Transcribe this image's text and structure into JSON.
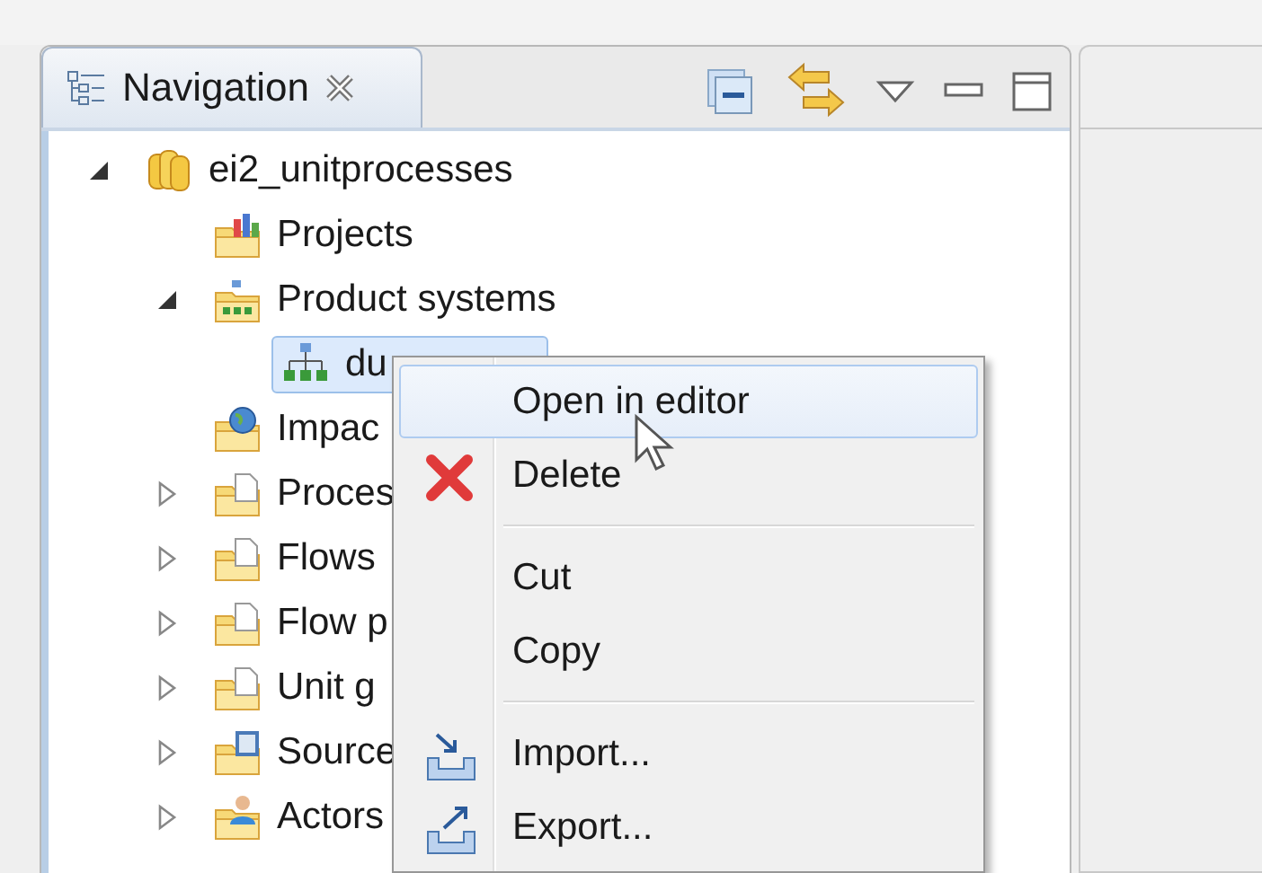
{
  "navigation": {
    "tab": {
      "title": "Navigation",
      "selected": true
    },
    "tree": [
      {
        "label": "ei2_unitprocesses",
        "kind": "database",
        "expanded": true,
        "selected": false,
        "children": [
          {
            "label": "Projects",
            "kind": "projects-folder",
            "selected": false
          },
          {
            "label": "Product systems",
            "kind": "systems-folder",
            "expanded": true,
            "selected": false,
            "children": [
              {
                "label": "du",
                "kind": "system",
                "selected": true
              }
            ]
          },
          {
            "label": "Impac",
            "kind": "globe-folder",
            "selected": false
          },
          {
            "label": "Proces",
            "kind": "letter-folder",
            "expanded": false,
            "selected": false
          },
          {
            "label": "Flows",
            "kind": "letter-folder",
            "expanded": false,
            "selected": false
          },
          {
            "label": "Flow p",
            "kind": "letter-folder",
            "expanded": false,
            "selected": false
          },
          {
            "label": "Unit g",
            "kind": "letter-folder",
            "expanded": false,
            "selected": false
          },
          {
            "label": "Source",
            "kind": "book-folder",
            "expanded": false,
            "selected": false
          },
          {
            "label": "Actors",
            "kind": "person-folder",
            "expanded": false,
            "selected": false
          }
        ]
      }
    ]
  },
  "context_menu": [
    {
      "kind": "item",
      "label": "Open in editor",
      "selected": true
    },
    {
      "kind": "delete",
      "label": "Delete",
      "selected": false
    },
    {
      "kind": "separator"
    },
    {
      "kind": "item",
      "label": "Cut",
      "selected": false
    },
    {
      "kind": "item",
      "label": "Copy",
      "selected": false
    },
    {
      "kind": "separator"
    },
    {
      "kind": "import",
      "label": "Import...",
      "selected": false
    },
    {
      "kind": "export",
      "label": "Export...",
      "selected": false
    }
  ]
}
